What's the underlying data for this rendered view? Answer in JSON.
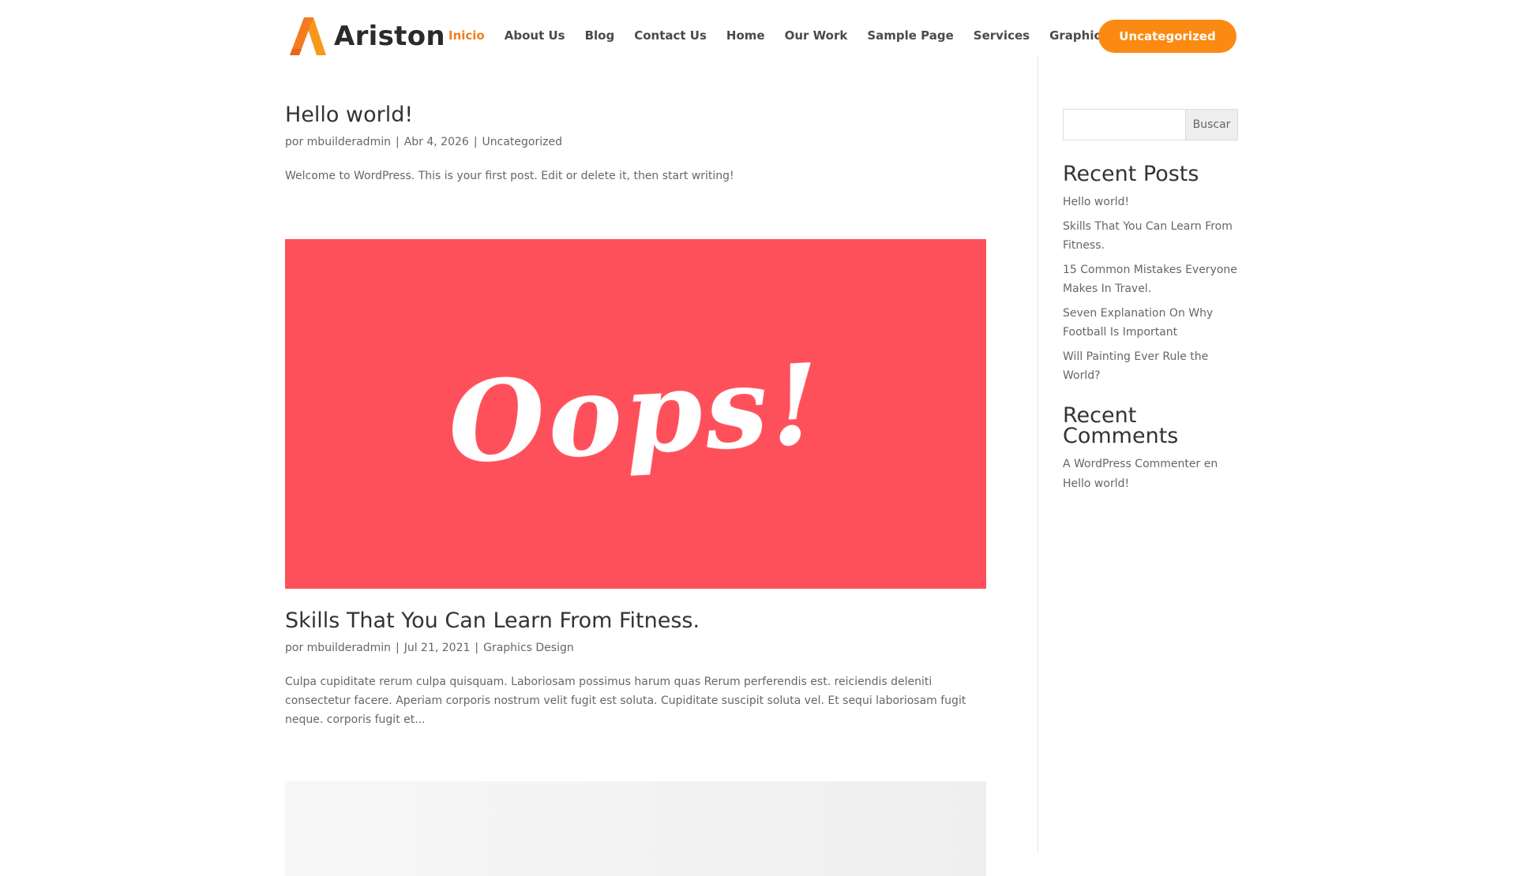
{
  "header": {
    "logo_text": "Ariston",
    "nav": [
      "Inicio",
      "About Us",
      "Blog",
      "Contact Us",
      "Home",
      "Our Work",
      "Sample Page",
      "Services",
      "Graphics Design"
    ],
    "cta_label": "Uncategorized"
  },
  "posts": [
    {
      "title": "Hello world!",
      "meta_prefix": "por",
      "author": "mbuilderadmin",
      "date": "Abr 4, 2026",
      "category": "Uncategorized",
      "excerpt": "Welcome to WordPress. This is your first post. Edit or delete it, then start writing!"
    },
    {
      "image_text": "Oops!",
      "title": "Skills That You Can Learn From Fitness.",
      "meta_prefix": "por",
      "author": "mbuilderadmin",
      "date": "Jul 21, 2021",
      "category": "Graphics Design",
      "excerpt": "Culpa cupiditate rerum culpa quisquam. Laboriosam possimus harum quas Rerum perferendis est. reiciendis deleniti consectetur facere. Aperiam corporis nostrum velit fugit est soluta. Cupiditate suscipit soluta vel. Et sequi laboriosam fugit neque. corporis fugit et..."
    }
  ],
  "sidebar": {
    "search_button": "Buscar",
    "search_placeholder": "",
    "recent_posts_title": "Recent Posts",
    "recent_posts": [
      "Hello world!",
      "Skills That You Can Learn From Fitness.",
      "15 Common Mistakes Everyone Makes In Travel.",
      "Seven Explanation On Why Football Is Important",
      "Will Painting Ever Rule the World?"
    ],
    "recent_comments_title": "Recent Comments",
    "comment_author": "A WordPress Commenter",
    "comment_joiner": "en",
    "comment_post": "Hello world!"
  },
  "colors": {
    "accent": "#f07f1b",
    "cta": "#fb8a12",
    "featured_bg": "#fe505b"
  }
}
